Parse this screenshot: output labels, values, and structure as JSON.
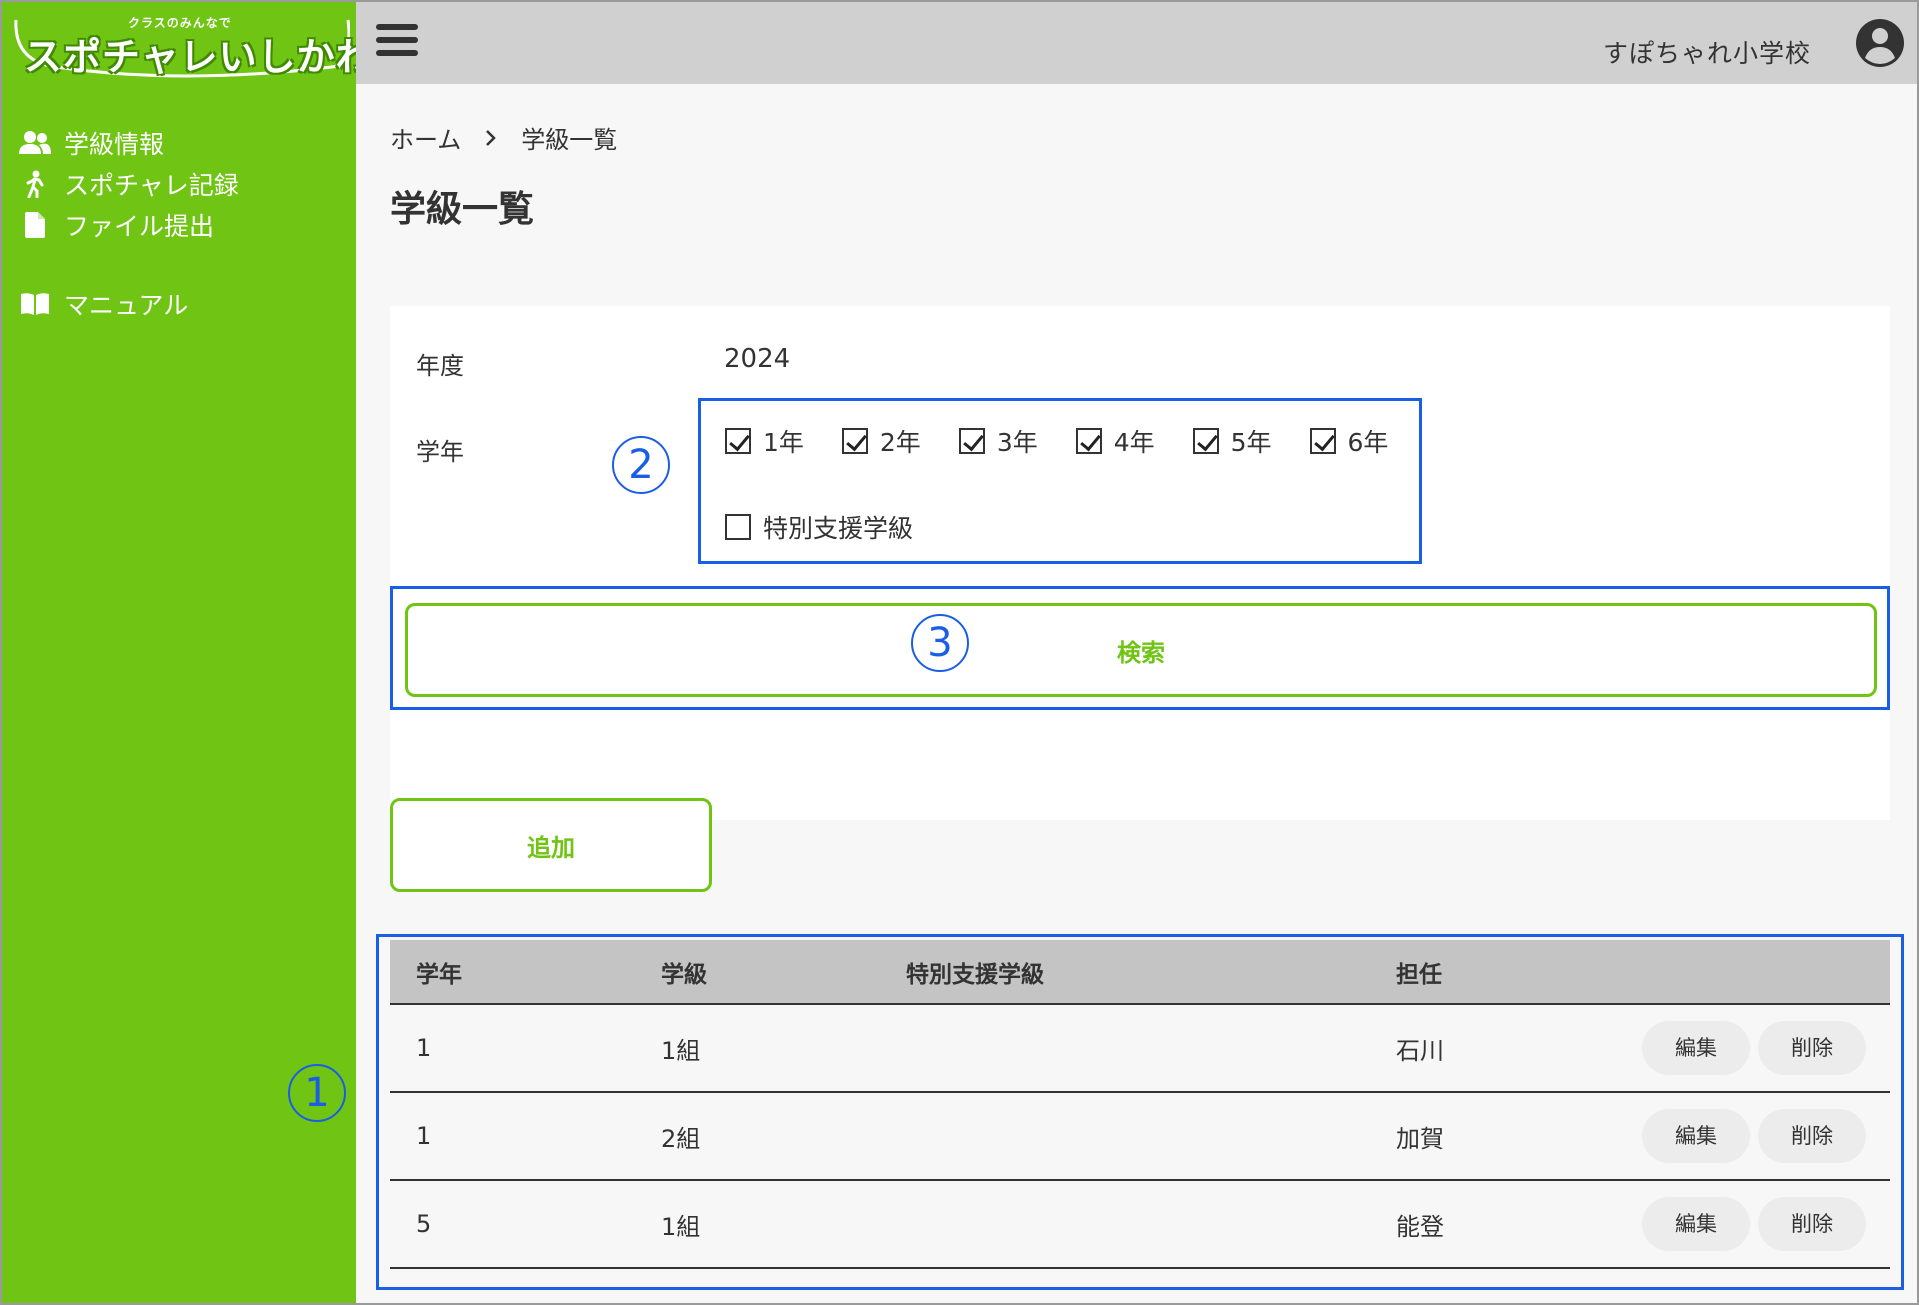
{
  "logo": {
    "subtitle": "クラスのみんなで",
    "title": "スポチャレいしかわ"
  },
  "sidebar": {
    "items": [
      {
        "label": "学級情報",
        "icon": "users-icon"
      },
      {
        "label": "スポチャレ記録",
        "icon": "runner-icon"
      },
      {
        "label": "ファイル提出",
        "icon": "file-icon"
      },
      {
        "label": "マニュアル",
        "icon": "book-icon"
      }
    ]
  },
  "header": {
    "school": "すぽちゃれ小学校"
  },
  "breadcrumb": {
    "home": "ホーム",
    "current": "学級一覧"
  },
  "page_title": "学級一覧",
  "search": {
    "year_label": "年度",
    "year_value": "2024",
    "grade_label": "学年",
    "grades": [
      {
        "label": "1年",
        "checked": true
      },
      {
        "label": "2年",
        "checked": true
      },
      {
        "label": "3年",
        "checked": true
      },
      {
        "label": "4年",
        "checked": true
      },
      {
        "label": "5年",
        "checked": true
      },
      {
        "label": "6年",
        "checked": true
      }
    ],
    "special_label": "特別支援学級",
    "special_checked": false,
    "button_label": "検索"
  },
  "add_label": "追加",
  "table": {
    "headers": [
      "学年",
      "学級",
      "特別支援学級",
      "担任",
      ""
    ],
    "rows": [
      {
        "grade": "1",
        "class": "1組",
        "special": "",
        "teacher": "石川",
        "edit": "編集",
        "delete": "削除"
      },
      {
        "grade": "1",
        "class": "2組",
        "special": "",
        "teacher": "加賀",
        "edit": "編集",
        "delete": "削除"
      },
      {
        "grade": "5",
        "class": "1組",
        "special": "",
        "teacher": "能登",
        "edit": "編集",
        "delete": "削除"
      }
    ]
  },
  "annotations": {
    "one": "1",
    "two": "2",
    "three": "3"
  },
  "colors": {
    "sidebar": "#6fc414",
    "accent": "#6fc414",
    "annotation": "#1a5ee6",
    "header": "#d0d0d0"
  }
}
